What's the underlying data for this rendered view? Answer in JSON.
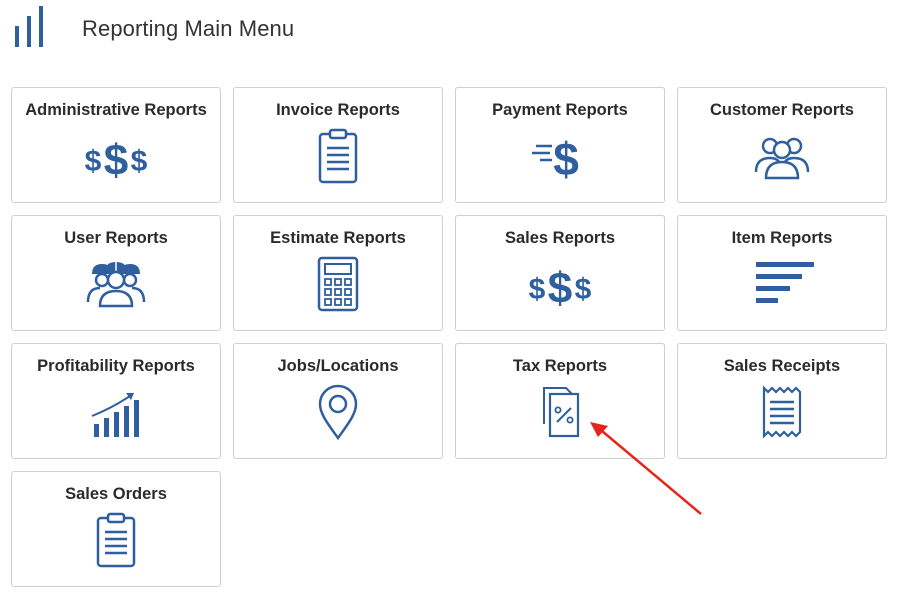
{
  "header": {
    "title": "Reporting Main Menu",
    "logo_icon": "bar-chart-logo-icon"
  },
  "accent_color": "#2f5f9e",
  "annotation_color": "#e8241a",
  "tiles": [
    {
      "label": "Administrative Reports",
      "icon": "triple-dollar-icon"
    },
    {
      "label": "Invoice Reports",
      "icon": "clipboard-icon"
    },
    {
      "label": "Payment Reports",
      "icon": "fast-dollar-icon"
    },
    {
      "label": "Customer Reports",
      "icon": "people-group-icon"
    },
    {
      "label": "User Reports",
      "icon": "workers-hardhat-icon"
    },
    {
      "label": "Estimate Reports",
      "icon": "calculator-icon"
    },
    {
      "label": "Sales Reports",
      "icon": "triple-dollar-icon"
    },
    {
      "label": "Item Reports",
      "icon": "sort-lines-icon"
    },
    {
      "label": "Profitability Reports",
      "icon": "growth-bars-icon"
    },
    {
      "label": "Jobs/Locations",
      "icon": "map-pin-icon"
    },
    {
      "label": "Tax Reports",
      "icon": "percent-documents-icon"
    },
    {
      "label": "Sales Receipts",
      "icon": "receipt-icon"
    },
    {
      "label": "Sales Orders",
      "icon": "clipboard-icon"
    }
  ]
}
